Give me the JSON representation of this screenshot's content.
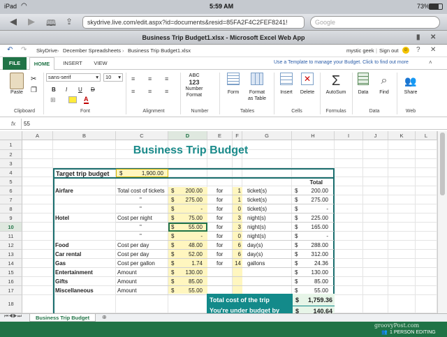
{
  "status": {
    "device": "iPad",
    "time": "5:59 AM",
    "battery": "73%"
  },
  "browser": {
    "url": "skydrive.live.com/edit.aspx?id=documents&resid=85FA2F4C2FEF8241!",
    "search_placeholder": "Google"
  },
  "window_title": "Business Trip Budget1.xlsx - Microsoft Excel Web App",
  "appbar": {
    "breadcrumb": [
      "SkyDrive",
      "December Spreadsheets",
      "Business Trip Budget1.xlsx"
    ],
    "user": "mystic geek",
    "signout": "Sign out",
    "template_msg": "Use a Template to manage your Budget. Click to find out more"
  },
  "tabs": [
    "FILE",
    "HOME",
    "INSERT",
    "VIEW"
  ],
  "ribbon": {
    "paste": "Paste",
    "font_name": "sans-serif",
    "font_size": "10",
    "bold": "B",
    "italic": "I",
    "underline": "U",
    "strike": "D",
    "font_color": "A",
    "abc": "ABC",
    "num123": "123",
    "number_format": [
      "Number",
      "Format"
    ],
    "format_table": [
      "Format",
      "as Table"
    ],
    "form": "Form",
    "insert": "Insert",
    "delete": "Delete",
    "autosum": "AutoSum",
    "data": "Data",
    "find": "Find",
    "share": "Share",
    "groups": [
      "Clipboard",
      "Font",
      "Alignment",
      "Number",
      "Tables",
      "Cells",
      "Formulas",
      "Data",
      "Web"
    ]
  },
  "formula": {
    "fx": "fx",
    "value": "55"
  },
  "columns": [
    "A",
    "B",
    "C",
    "D",
    "E",
    "F",
    "G",
    "H",
    "I",
    "J",
    "K",
    "L"
  ],
  "rows": [
    "1",
    "2",
    "3",
    "4",
    "5",
    "6",
    "7",
    "8",
    "9",
    "10",
    "11",
    "12",
    "13",
    "14",
    "15",
    "16",
    "17",
    "18"
  ],
  "sheet": {
    "title": "Business Trip Budget",
    "target_label": "Target trip budget",
    "target_cur": "$",
    "target_val": "1,900.00",
    "total_hdr": "Total",
    "rows": [
      {
        "cat": "Airfare",
        "desc": "Total cost of tickets",
        "amt": "200.00",
        "for": "for",
        "qty": "1",
        "unit": "ticket(s)",
        "tot": "200.00"
      },
      {
        "cat": "",
        "desc": "\"",
        "amt": "275.00",
        "for": "for",
        "qty": "1",
        "unit": "ticket(s)",
        "tot": "275.00"
      },
      {
        "cat": "",
        "desc": "\"",
        "amt": "-",
        "for": "for",
        "qty": "0",
        "unit": "ticket(s)",
        "tot": "-"
      },
      {
        "cat": "Hotel",
        "desc": "Cost per night",
        "amt": "75.00",
        "for": "for",
        "qty": "3",
        "unit": "night(s)",
        "tot": "225.00"
      },
      {
        "cat": "",
        "desc": "\"",
        "amt": "55.00",
        "for": "for",
        "qty": "3",
        "unit": "night(s)",
        "tot": "165.00"
      },
      {
        "cat": "",
        "desc": "\"",
        "amt": "-",
        "for": "for",
        "qty": "0",
        "unit": "night(s)",
        "tot": "-"
      },
      {
        "cat": "Food",
        "desc": "Cost per day",
        "amt": "48.00",
        "for": "for",
        "qty": "6",
        "unit": "day(s)",
        "tot": "288.00"
      },
      {
        "cat": "Car rental",
        "desc": "Cost per day",
        "amt": "52.00",
        "for": "for",
        "qty": "6",
        "unit": "day(s)",
        "tot": "312.00"
      },
      {
        "cat": "Gas",
        "desc": "Cost per gallon",
        "amt": "1.74",
        "for": "for",
        "qty": "14",
        "unit": "gallons",
        "tot": "24.36"
      },
      {
        "cat": "Entertainment",
        "desc": "Amount",
        "amt": "130.00",
        "for": "",
        "qty": "",
        "unit": "",
        "tot": "130.00"
      },
      {
        "cat": "Gifts",
        "desc": "Amount",
        "amt": "85.00",
        "for": "",
        "qty": "",
        "unit": "",
        "tot": "85.00"
      },
      {
        "cat": "Miscellaneous",
        "desc": "Amount",
        "amt": "55.00",
        "for": "",
        "qty": "",
        "unit": "",
        "tot": "55.00"
      }
    ],
    "cur": "$",
    "total_label": "Total cost of the trip",
    "total_value": "1,759.36",
    "under_label": "You're under budget by",
    "under_value": "140.64"
  },
  "sheet_tab": "Business Trip Budget",
  "watermark": "groovyPost.com",
  "editing": "1 PERSON EDITING"
}
